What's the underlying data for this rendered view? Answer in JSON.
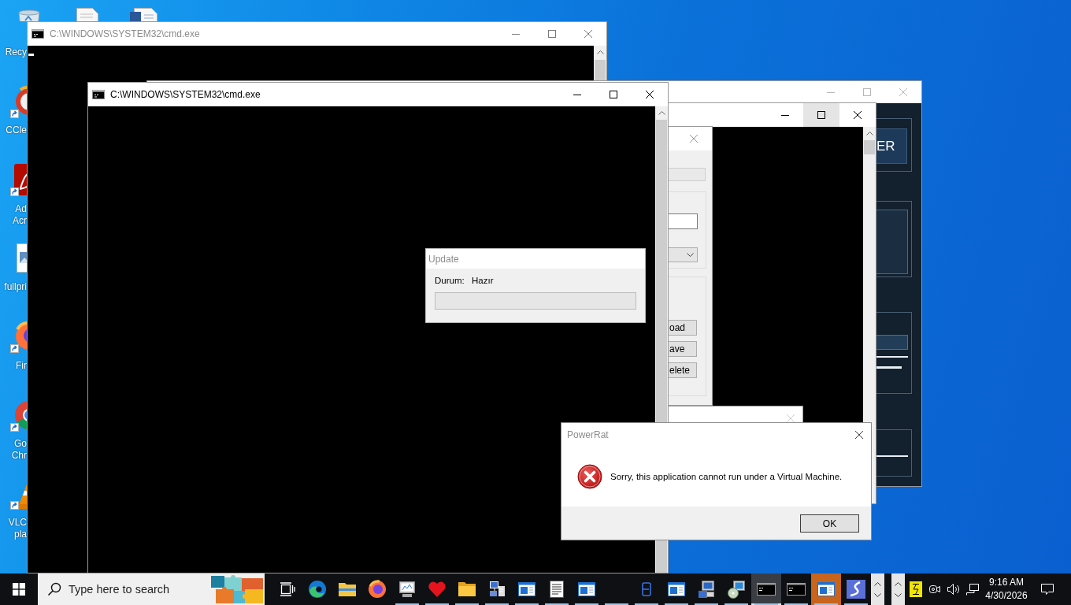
{
  "desktop_icons": [
    {
      "kind": "recyclebin",
      "shortcut": false,
      "label_lines": [
        "Recy"
      ]
    },
    {
      "kind": "cleaner",
      "shortcut": true,
      "label_lines": [
        "CCle"
      ]
    },
    {
      "kind": "pdf",
      "shortcut": true,
      "label_lines": [
        "Ad",
        "Acr"
      ]
    },
    {
      "kind": "image",
      "shortcut": false,
      "label_lines": [
        "fullpri"
      ]
    },
    {
      "kind": "firefox",
      "shortcut": true,
      "label_lines": [
        "Fir"
      ]
    },
    {
      "kind": "chrome",
      "shortcut": true,
      "label_lines": [
        "Go",
        "Chr"
      ]
    },
    {
      "kind": "cone",
      "shortcut": true,
      "label_lines": [
        "VLC",
        "pla"
      ]
    }
  ],
  "console_windows": [
    {
      "title": "C:\\WINDOWS\\SYSTEM32\\cmd.exe",
      "active": false
    },
    {
      "title": "C:\\WINDOWS\\SYSTEM32\\cmd.exe",
      "active": true
    }
  ],
  "rear_console": {
    "maximize_hovered": true
  },
  "app_window": {
    "button_label": "ER"
  },
  "form_window": {
    "buttons": [
      "oad",
      "ave",
      "elete"
    ]
  },
  "update_dialog": {
    "title": "Update",
    "status_label": "Durum:",
    "status_value": "Hazır",
    "progress": {
      "level": 0
    }
  },
  "message_box": {
    "title": "PowerRat",
    "message": "Sorry, this application cannot run under a Virtual Machine.",
    "buttons": [
      "OK"
    ]
  },
  "taskbar": {
    "search": {
      "placeholder": "Type here to search"
    },
    "apps": [
      {
        "kind": "taskview",
        "running": false,
        "selected": false,
        "flashing": false
      },
      {
        "kind": "edge",
        "running": false,
        "selected": false,
        "flashing": false
      },
      {
        "kind": "explorer",
        "running": false,
        "selected": false,
        "flashing": false
      },
      {
        "kind": "firefox",
        "running": false,
        "selected": false,
        "flashing": false
      },
      {
        "kind": "monitor",
        "running": true,
        "selected": false,
        "flashing": false
      },
      {
        "kind": "heart",
        "running": true,
        "selected": false,
        "flashing": false
      },
      {
        "kind": "folder",
        "running": true,
        "selected": false,
        "flashing": false
      },
      {
        "kind": "network",
        "running": true,
        "selected": false,
        "flashing": false
      },
      {
        "kind": "window",
        "running": true,
        "selected": false,
        "flashing": false
      },
      {
        "kind": "document",
        "running": true,
        "selected": false,
        "flashing": false
      },
      {
        "kind": "window",
        "running": true,
        "selected": false,
        "flashing": false
      },
      {
        "kind": "blank",
        "running": true,
        "selected": false,
        "flashing": false
      },
      {
        "kind": "file",
        "running": true,
        "selected": false,
        "flashing": false
      },
      {
        "kind": "window",
        "running": true,
        "selected": false,
        "flashing": false
      },
      {
        "kind": "computer",
        "running": true,
        "selected": false,
        "flashing": false
      },
      {
        "kind": "setup",
        "running": true,
        "selected": false,
        "flashing": false
      },
      {
        "kind": "console",
        "running": true,
        "selected": true,
        "flashing": false
      },
      {
        "kind": "console",
        "running": true,
        "selected": false,
        "flashing": false
      },
      {
        "kind": "window",
        "running": true,
        "selected": false,
        "flashing": true
      },
      {
        "kind": "swirl",
        "running": true,
        "selected": false,
        "flashing": false
      }
    ],
    "clock": {
      "time": "9:16 AM",
      "date": "4/30/2026"
    }
  }
}
